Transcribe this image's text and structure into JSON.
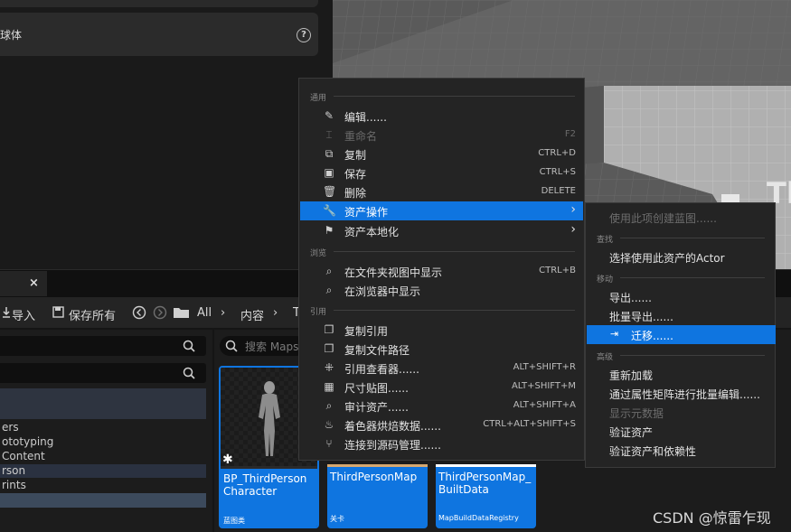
{
  "details": {
    "card_label": "球体",
    "help_glyph": "?"
  },
  "viewport": {
    "overlay_text": "Th"
  },
  "content_browser": {
    "tab_close": "×",
    "import_label": "导入",
    "save_all_label": "保存所有",
    "breadcrumb": [
      "All",
      "内容",
      "T"
    ],
    "breadcrumb_sep": "›",
    "asset_search_placeholder": "搜索 Maps",
    "tree_items": [
      "ers",
      "ototyping",
      "Content",
      "rson",
      "rints"
    ],
    "assets": [
      {
        "name": "BP_ThirdPerson Character",
        "type": "蓝图类"
      },
      {
        "name": "ThirdPersonMap",
        "type": "关卡"
      },
      {
        "name": "ThirdPersonMap_ BuiltData",
        "type": "MapBuildDataRegistry"
      }
    ]
  },
  "context_menu": {
    "sections": [
      "通用",
      "浏览",
      "引用"
    ],
    "items": [
      {
        "label": "编辑......",
        "shortcut": "",
        "icon": "pencil-icon"
      },
      {
        "label": "重命名",
        "shortcut": "F2",
        "icon": "rename-icon"
      },
      {
        "label": "复制",
        "shortcut": "CTRL+D",
        "icon": "duplicate-icon"
      },
      {
        "label": "保存",
        "shortcut": "CTRL+S",
        "icon": "save-icon"
      },
      {
        "label": "删除",
        "shortcut": "DELETE",
        "icon": "trash-icon"
      },
      {
        "label": "资产操作",
        "shortcut": "",
        "icon": "wrench-icon"
      },
      {
        "label": "资产本地化",
        "shortcut": "",
        "icon": "flag-icon"
      },
      {
        "label": "在文件夹视图中显示",
        "shortcut": "CTRL+B",
        "icon": "folder-search-icon"
      },
      {
        "label": "在浏览器中显示",
        "shortcut": "",
        "icon": "browser-search-icon"
      },
      {
        "label": "复制引用",
        "shortcut": "",
        "icon": "copy-reference-icon"
      },
      {
        "label": "复制文件路径",
        "shortcut": "",
        "icon": "copy-path-icon"
      },
      {
        "label": "引用查看器......",
        "shortcut": "ALT+SHIFT+R",
        "icon": "reference-viewer-icon"
      },
      {
        "label": "尺寸贴图......",
        "shortcut": "ALT+SHIFT+M",
        "icon": "size-map-icon"
      },
      {
        "label": "审计资产......",
        "shortcut": "ALT+SHIFT+A",
        "icon": "audit-icon"
      },
      {
        "label": "着色器烘焙数据......",
        "shortcut": "CTRL+ALT+SHIFT+S",
        "icon": "shader-icon"
      },
      {
        "label": "连接到源码管理......",
        "shortcut": "",
        "icon": "source-control-icon"
      }
    ],
    "submenu_arrow": "›"
  },
  "submenu": {
    "sections": [
      "查找",
      "移动",
      "高级"
    ],
    "items": [
      {
        "label": "使用此项创建蓝图......"
      },
      {
        "label": "选择使用此资产的Actor"
      },
      {
        "label": "导出......"
      },
      {
        "label": "批量导出......"
      },
      {
        "label": "迁移......"
      },
      {
        "label": "重新加载"
      },
      {
        "label": "通过属性矩阵进行批量编辑......"
      },
      {
        "label": "显示元数据"
      },
      {
        "label": "验证资产"
      },
      {
        "label": "验证资产和依赖性"
      }
    ]
  },
  "watermark": "CSDN @惊雷乍现"
}
